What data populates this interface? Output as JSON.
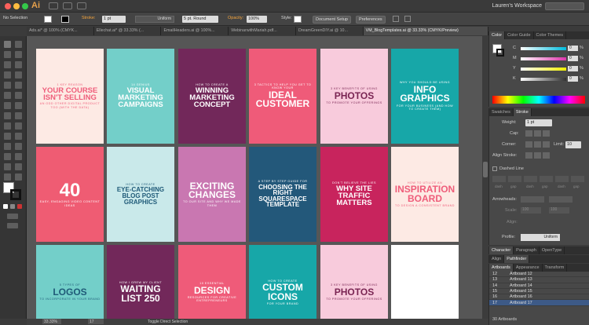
{
  "titlebar": {
    "app_logo": "Ai",
    "workspace": "Lauren's Workspace"
  },
  "control": {
    "selection": "No Selection",
    "stroke_label": "Stroke:",
    "stroke_weight": "1 pt",
    "profile": "Uniform",
    "brush": "5 pt. Round",
    "opacity_label": "Opacity:",
    "opacity": "100%",
    "style_label": "Style:",
    "doc_setup": "Document Setup",
    "prefs": "Preferences"
  },
  "tabs": [
    {
      "label": "Ads.ai* @ 100% (CMYK..."
    },
    {
      "label": "Ellechat.ai* @ 33.33% (..."
    },
    {
      "label": "EmailHeaders.ai @ 100%..."
    },
    {
      "label": "WebinarwithMariah.pdf..."
    },
    {
      "label": "DreamGreenDIY.ai @ 10..."
    },
    {
      "label": "VM_BlogTemplates.ai @ 33.33% (CMYK/Preview)"
    }
  ],
  "artboards": [
    {
      "bg": "#fdeae4",
      "fg": "#ef5d7a",
      "small": "1 KEY REASON",
      "big": "YOUR COURSE ISN'T SELLING",
      "foot": "AN ODD OTHER DIGITAL PRODUCT TOO (WITH THE DATA)"
    },
    {
      "bg": "#73cfc9",
      "fg": "#ffffff",
      "small": "14 GENIUS",
      "big": "VISUAL MARKETING CAMPAIGNS",
      "foot": ""
    },
    {
      "bg": "#72285a",
      "fg": "#ffffff",
      "small": "HOW TO CREATE A",
      "big": "WINNING MARKETING CONCEPT",
      "foot": ""
    },
    {
      "bg": "#ef5b79",
      "fg": "#ffffff",
      "small": "3 TACTICS TO HELP YOU GET TO KNOW YOUR",
      "big": "IDEAL CUSTOMER",
      "foot": ""
    },
    {
      "bg": "#f8cbdc",
      "fg": "#7a2553",
      "small": "3 KEY BENEFITS OF USING",
      "big": "PHOTOS",
      "foot": "TO PROMOTE YOUR OFFERINGS"
    },
    {
      "bg": "#17a7a8",
      "fg": "#ffffff",
      "small": "WHY YOU SHOULD BE USING",
      "big": "INFO GRAPHICS",
      "foot": "FOR YOUR BUSINESS (AND HOW TO CREATE THEM)"
    },
    {
      "bg": "#ef5c73",
      "fg": "#ffffff",
      "small": "",
      "big": "40",
      "foot": "EASY, ENGAGING VIDEO CONTENT IDEAS"
    },
    {
      "bg": "#c9e9ea",
      "fg": "#1f5a78",
      "small": "HOW TO CREATE",
      "big": "EYE-CATCHING BLOG POST GRAPHICS",
      "foot": ""
    },
    {
      "bg": "#c977b1",
      "fg": "#ffffff",
      "small": "",
      "big": "EXCITING CHANGES",
      "foot": "TO OUR SITE AND WHY WE MADE THEM"
    },
    {
      "bg": "#23587a",
      "fg": "#ffffff",
      "small": "A STEP BY STEP GUIDE FOR",
      "big": "CHOOSING THE RIGHT SQUARESPACE TEMPLATE",
      "foot": ""
    },
    {
      "bg": "#c8245d",
      "fg": "#ffffff",
      "small": "DON'T BELIEVE THE LIES",
      "big": "WHY SITE TRAFFIC MATTERS",
      "foot": ""
    },
    {
      "bg": "#fdeae4",
      "fg": "#ef5d7a",
      "small": "HOW TO UTILIZE AN",
      "big": "INSPIRATION BOARD",
      "foot": "TO DESIGN A CONSISTENT BRAND"
    },
    {
      "bg": "#73cfc9",
      "fg": "#1f5a78",
      "small": "5 TYPES OF",
      "big": "LOGOS",
      "foot": "TO INCORPORATE IN YOUR BRAND"
    },
    {
      "bg": "#72285a",
      "fg": "#ffffff",
      "small": "HOW I GREW MY CLIENT",
      "big": "WAITING LIST 250",
      "foot": ""
    },
    {
      "bg": "#ef5b79",
      "fg": "#ffffff",
      "small": "10 ESSENTIAL",
      "big": "DESIGN",
      "foot": "RESOURCES FOR CREATIVE ENTREPRENEURS"
    },
    {
      "bg": "#17a7a8",
      "fg": "#ffffff",
      "small": "HOW TO CREATE",
      "big": "CUSTOM ICONS",
      "foot": "FOR YOUR BRAND"
    },
    {
      "bg": "#f8cbdc",
      "fg": "#7a2553",
      "small": "3 KEY BENEFITS OF USING",
      "big": "PHOTOS",
      "foot": "TO PROMOTE YOUR OFFERINGS"
    },
    {
      "bg": "#ffffff",
      "fg": "#ffffff",
      "small": "",
      "big": "",
      "foot": ""
    }
  ],
  "color_panel": {
    "tabs": [
      "Color",
      "Color Guide",
      "Color Themes"
    ],
    "rows": [
      {
        "ch": "C",
        "val": "0",
        "unit": "%"
      },
      {
        "ch": "M",
        "val": "0",
        "unit": "%"
      },
      {
        "ch": "Y",
        "val": "0",
        "unit": "%"
      },
      {
        "ch": "K",
        "val": "0",
        "unit": "%"
      }
    ]
  },
  "stroke_panel": {
    "tabs": [
      "Swatches",
      "Stroke"
    ],
    "weight_label": "Weight:",
    "weight": "1 pt",
    "cap_label": "Cap:",
    "corner_label": "Corner:",
    "limit_label": "Limit:",
    "limit": "10",
    "align_label": "Align Stroke:",
    "dashed": "Dashed Line",
    "dash_labels": [
      "dash",
      "gap",
      "dash",
      "gap",
      "dash",
      "gap"
    ],
    "arrowheads": "Arrowheads:",
    "scale": "Scale:",
    "scale1": "100",
    "scale2": "100",
    "align2": "Align:",
    "profile_label": "Profile:",
    "profile": "Uniform"
  },
  "char_panel": {
    "tabs": [
      "Character",
      "Paragraph",
      "OpenType"
    ]
  },
  "align_panel": {
    "tabs": [
      "Align",
      "Pathfinder"
    ]
  },
  "artboards_panel": {
    "tabs": [
      "Artboards",
      "Appearance",
      "Transform"
    ],
    "rows": [
      {
        "num": "12",
        "name": "Artboard 12"
      },
      {
        "num": "13",
        "name": "Artboard 13"
      },
      {
        "num": "14",
        "name": "Artboard 14"
      },
      {
        "num": "15",
        "name": "Artboard 15"
      },
      {
        "num": "16",
        "name": "Artboard 16"
      },
      {
        "num": "17",
        "name": "Artboard 17"
      }
    ],
    "count": "30 Artboards"
  },
  "status": {
    "zoom": "33.33%",
    "page": "17",
    "tool": "Toggle Direct Selection"
  },
  "colors": {
    "accent": "#f6a53c",
    "selected": "#3d5a87"
  }
}
